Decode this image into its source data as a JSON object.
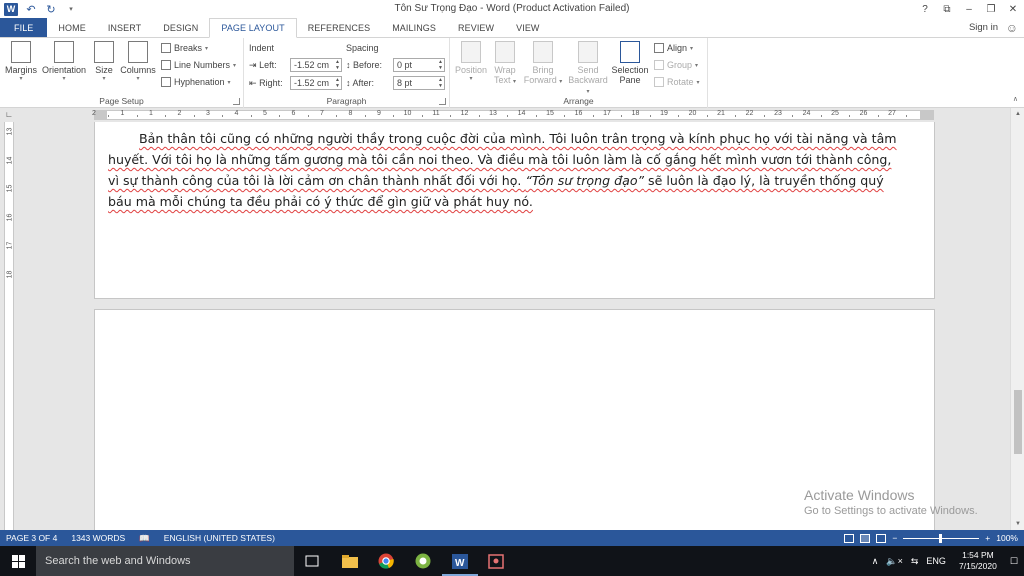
{
  "window": {
    "title": "Tôn Sư Trọng Đạo - Word (Product Activation Failed)",
    "controls": [
      "?",
      "⧉",
      "–",
      "❐",
      "✕"
    ]
  },
  "qat": {
    "undo": "↶",
    "redo": "↻"
  },
  "tabs": [
    "FILE",
    "HOME",
    "INSERT",
    "DESIGN",
    "PAGE LAYOUT",
    "REFERENCES",
    "MAILINGS",
    "REVIEW",
    "VIEW"
  ],
  "active_tab": "PAGE LAYOUT",
  "signin": "Sign in",
  "ribbon": {
    "page_setup": {
      "label": "Page Setup",
      "margins": "Margins",
      "orientation": "Orientation",
      "size": "Size",
      "columns": "Columns",
      "breaks": "Breaks",
      "line_numbers": "Line Numbers",
      "hyphenation": "Hyphenation"
    },
    "paragraph": {
      "label": "Paragraph",
      "indent": "Indent",
      "spacing": "Spacing",
      "left_label": "Left:",
      "left_value": "-1.52 cm",
      "right_label": "Right:",
      "right_value": "-1.52 cm",
      "before_label": "Before:",
      "before_value": "0 pt",
      "after_label": "After:",
      "after_value": "8 pt"
    },
    "arrange": {
      "label": "Arrange",
      "position": "Position",
      "wrap_text_1": "Wrap",
      "wrap_text_2": "Text",
      "bring_forward_1": "Bring",
      "bring_forward_2": "Forward",
      "send_backward_1": "Send",
      "send_backward_2": "Backward",
      "selection_pane_1": "Selection",
      "selection_pane_2": "Pane",
      "align": "Align",
      "group": "Group",
      "rotate": "Rotate"
    }
  },
  "ruler": {
    "numbers": [
      "2",
      "1",
      "1",
      "2",
      "3",
      "4",
      "5",
      "6",
      "7",
      "8",
      "9",
      "10",
      "11",
      "12",
      "13",
      "14",
      "15",
      "16",
      "17",
      "18",
      "19",
      "20",
      "21",
      "22",
      "23",
      "24",
      "25",
      "26",
      "27"
    ],
    "vertical_numbers": [
      "13",
      "14",
      "15",
      "16",
      "17",
      "18"
    ]
  },
  "document": {
    "lines": [
      "Bản thân tôi cũng có những người thầy trong cuộc đời của mình. Tôi luôn trân trọng và kính phục họ với tài năng và tâm",
      "huyết. Với tôi họ là những tấm gương mà tôi cần noi theo. Và điều mà tôi luôn làm là cố gắng hết mình vươn tới thành công,",
      "vì sự thành công của tôi là lời cảm ơn chân thành nhất đối với họ. ",
      "báu mà mỗi chúng ta đều phải có ý thức để gìn giữ và phát huy nó."
    ],
    "italic_quote": "“Tôn sư trọng đạo”",
    "line3_tail": " sẽ luôn là đạo lý, là truyền thống quý"
  },
  "watermark": {
    "line1": "Activate Windows",
    "line2": "Go to Settings to activate Windows."
  },
  "statusbar": {
    "page": "PAGE 3 OF 4",
    "words": "1343 WORDS",
    "language": "ENGLISH (UNITED STATES)",
    "zoom": "100%",
    "zoom_minus": "−",
    "zoom_plus": "+"
  },
  "taskbar": {
    "search_placeholder": "Search the web and Windows",
    "time": "1:54 PM",
    "date": "7/15/2020",
    "lang": "ENG",
    "tray_chevron": "∧",
    "volume": "🔈×",
    "network": "⇆",
    "notify": "☐"
  },
  "colors": {
    "accent": "#2b579a",
    "spell_underline": "#e04040",
    "taskbar": "#101318"
  }
}
